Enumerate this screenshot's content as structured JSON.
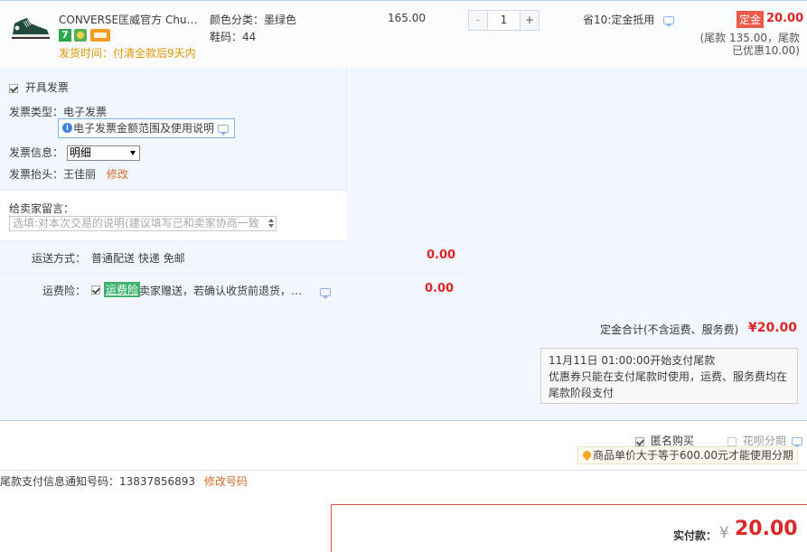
{
  "product": {
    "title": "CONVERSE匡威官方 Chuck ...",
    "badge_7": "7",
    "ship_time": "发货时间：付清全款后9天内",
    "spec_color": "颜色分类：墨绿色",
    "spec_size": "鞋码：44",
    "unit_price": "165.00",
    "qty_minus": "-",
    "qty_value": "1",
    "qty_plus": "+",
    "save_text": "省10:定金抵用",
    "deposit_tag": "定金",
    "deposit_amount": "20.00",
    "balance_line1": "(尾款 135.00，尾款",
    "balance_line2": "已优惠10.00)"
  },
  "invoice": {
    "checkbox_label": "开具发票",
    "type_label": "发票类型：",
    "type_value": "电子发票",
    "scope_link": "电子发票金额范围及使用说明",
    "info_label": "发票信息：",
    "info_select": "明细",
    "head_label": "发票抬头：",
    "head_value": "王佳丽",
    "modify_link": "修改"
  },
  "message": {
    "label": "给卖家留言：",
    "placeholder": "选填:对本次交易的说明(建议填写已和卖家协商一致"
  },
  "shipping": {
    "label": "运送方式：",
    "value": "普通配送 快递 免邮",
    "amount": "0.00"
  },
  "insurance": {
    "label": "运费险：",
    "tag": "运费险",
    "desc": "卖家赠送，若确认收货前退货，可获保险赔付",
    "amount": "0.00"
  },
  "deposit_total": {
    "label": "定金合计(不含运费、服务费)",
    "amount": "¥20.00"
  },
  "notice": {
    "line1": "11月11日 01:00:00开始支付尾款",
    "line2": "优惠券只能在支付尾款时使用，运费、服务费均在尾款阶段支付"
  },
  "options": {
    "anonymous": "匿名购买",
    "huabei": "花呗分期",
    "tip": "商品单价大于等于600.00元才能使用分期"
  },
  "notify": {
    "label": "尾款支付信息通知号码：",
    "phone": "13837856893",
    "modify": "修改号码"
  },
  "payment": {
    "label": "实付款：",
    "currency": "¥",
    "amount": "20.00"
  },
  "colors": {
    "accent_red": "#dd2727",
    "panel_bg": "#f2f7ff",
    "link_orange": "#d36a2b"
  }
}
